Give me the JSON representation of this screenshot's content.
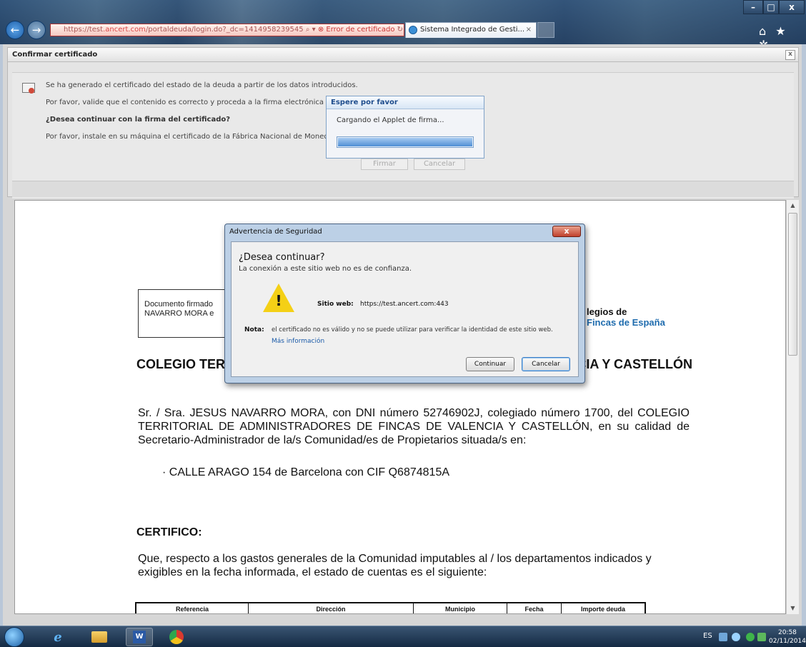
{
  "browser": {
    "address_prefix": "https://test",
    "address_host": ".ancert.com",
    "address_path": "/portaldeuda/login.do?_dc=1414958239545",
    "cert_error": "Error de certificado",
    "tab_title": "Sistema Integrado de Gesti...",
    "tab_close": "×",
    "toolbar_icons": "⌂ ★ ✲",
    "win_min": "–",
    "win_max": "□",
    "win_close": "x"
  },
  "confirm_panel": {
    "title": "Confirmar certificado",
    "close": "x",
    "line1": "Se ha generado el certificado del estado de la deuda a partir de los datos introducidos.",
    "line2": "Por favor, valide que el contenido es correcto y proceda a la firma electrónica del m",
    "line3": "¿Desea continuar con la firma del certificado?",
    "line4": "Por favor, instale en su máquina el certificado de la Fábrica Nacional de Moneda y T",
    "btn_firmar": "Firmar",
    "btn_cancelar": "Cancelar"
  },
  "espere": {
    "title": "Espere por favor",
    "message": "Cargando el Applet de firma...",
    "progress": 1.0
  },
  "document": {
    "signed_text": "Documento firmado",
    "signed_text2": "NAVARRO MORA e",
    "org_line1": "legios de",
    "org_line2": "Fincas de España",
    "heading": "COLEGIO TERRITORIAL DE ADMINISTRADORES DE FINCAS DE VALENCIA Y CASTELLÓN",
    "para1": "Sr. / Sra. JESUS NAVARRO MORA, con DNI número 52746902J, colegiado número 1700, del COLEGIO TERRITORIAL DE ADMINISTRADORES DE FINCAS DE VALENCIA Y CASTELLÓN, en su calidad de Secretario-Administrador de la/s Comunidad/es de Propietarios situada/s en:",
    "address": "· CALLE ARAGO 154 de Barcelona con CIF Q6874815A",
    "certifico": "CERTIFICO:",
    "para2": "Que, respecto a los gastos generales de la Comunidad imputables al / los departamentos indicados y exigibles en la fecha informada, el estado de cuentas es el siguiente:",
    "table_headers": [
      "Referencia",
      "Dirección",
      "Municipio",
      "Fecha",
      "Importe deuda"
    ]
  },
  "security_dialog": {
    "title": "Advertencia de Seguridad",
    "close": "x",
    "question": "¿Desea continuar?",
    "subtitle": "La conexión a este sitio web no es de confianza.",
    "site_label": "Sitio web:",
    "site_value": "https://test.ancert.com:443",
    "note_label": "Nota:",
    "note_text": "el certificado no es válido y no se puede utilizar para verificar la identidad de este sitio web.",
    "more_info": "Más información",
    "btn_continue": "Continuar",
    "btn_cancel": "Cancelar"
  },
  "taskbar": {
    "lang": "ES",
    "word_label": "W",
    "ie_label": "e",
    "time": "20:58",
    "date": "02/11/2014"
  }
}
